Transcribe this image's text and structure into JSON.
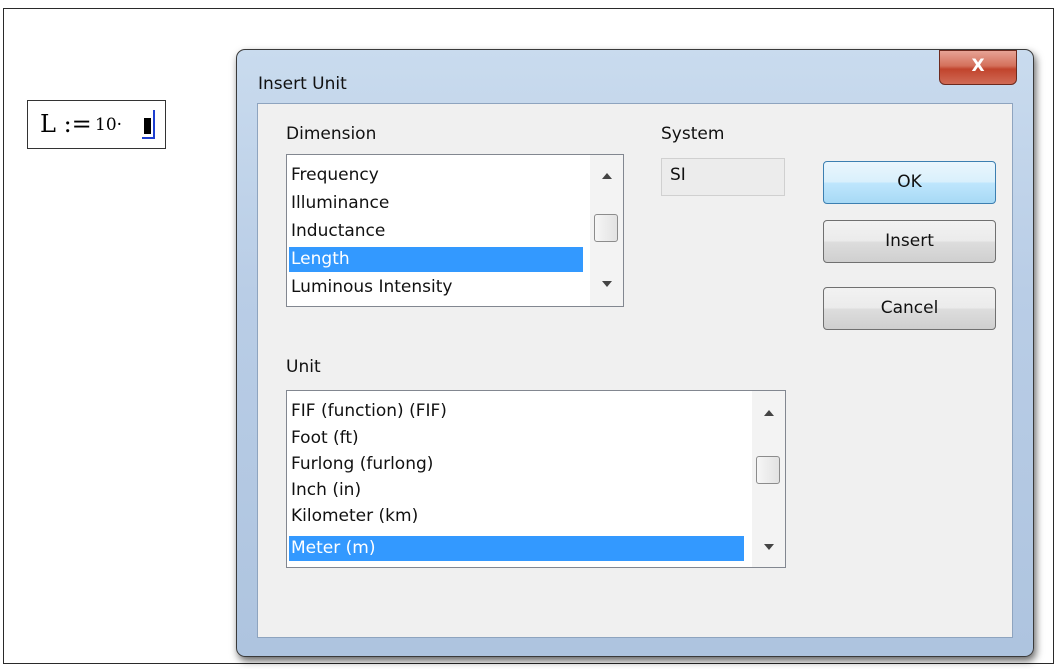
{
  "worksheet": {
    "math": {
      "lhs": "L :=",
      "rhs": "10·"
    }
  },
  "dialog": {
    "title": "Insert Unit",
    "close_label": "X",
    "dimension": {
      "label": "Dimension",
      "items": [
        "Frequency",
        "Illuminance",
        "Inductance",
        "Length",
        "Luminous Intensity"
      ],
      "selected": "Length"
    },
    "system": {
      "label": "System",
      "value": "SI"
    },
    "unit": {
      "label": "Unit",
      "items": [
        "FIF (function) (FIF)",
        "Foot (ft)",
        "Furlong (furlong)",
        "Inch (in)",
        "Kilometer (km)",
        "Meter (m)"
      ],
      "selected": "Meter (m)"
    },
    "buttons": {
      "ok": "OK",
      "insert": "Insert",
      "cancel": "Cancel"
    }
  },
  "colors": {
    "selection": "#3399ff",
    "cursor": "#1e3fd0",
    "close_button": "#c1442d"
  }
}
